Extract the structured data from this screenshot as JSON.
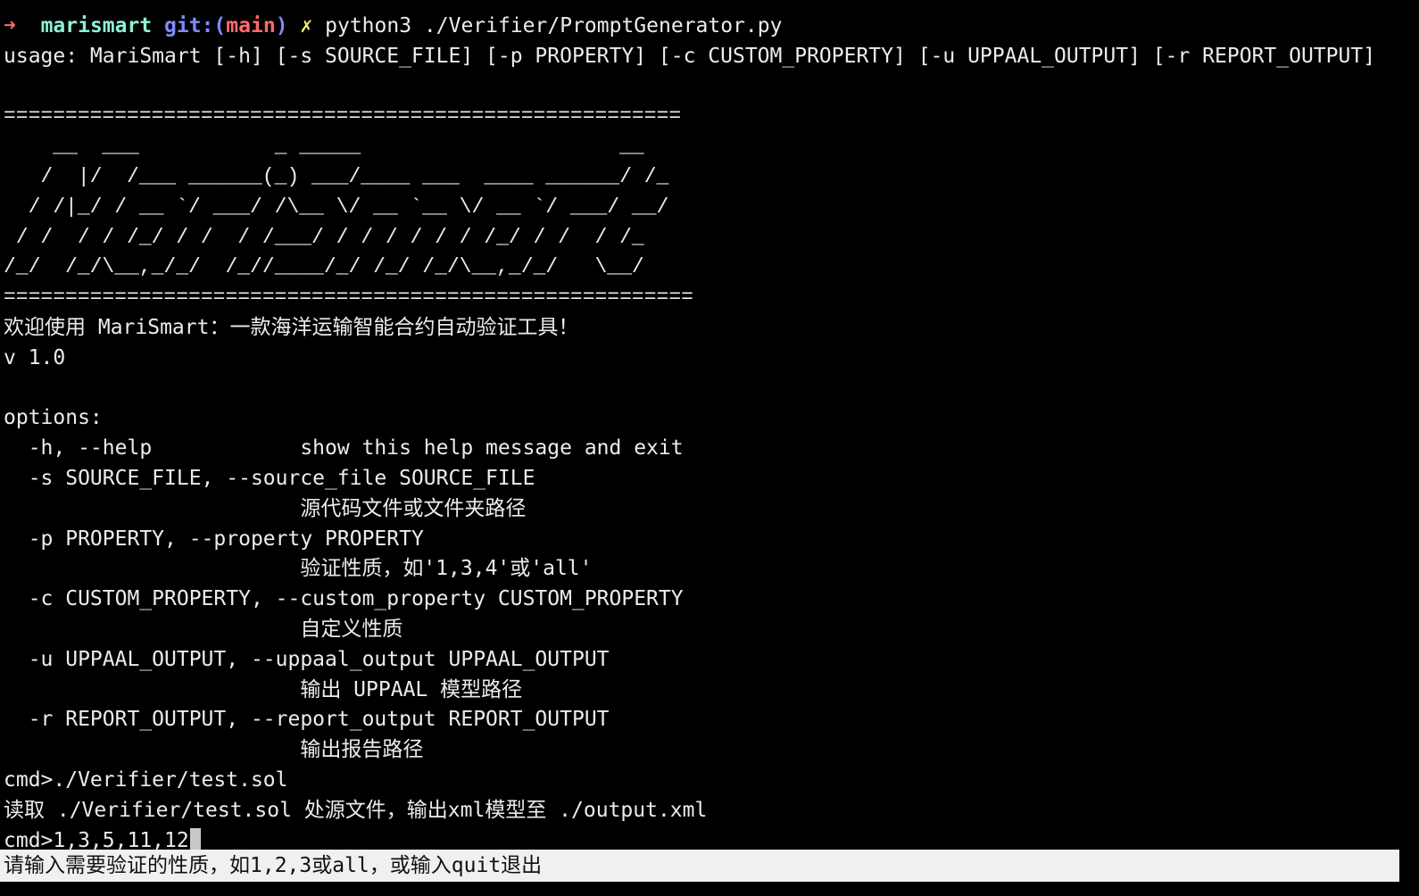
{
  "colors": {
    "background": "#000000",
    "text": "#ececec",
    "prompt_arrow": "#ff6a6a",
    "directory": "#8ff0d6",
    "git_label": "#7f8cff",
    "branch": "#ff6a6a",
    "dirty_marker": "#f3e96b",
    "status_bar_bg": "#f0f0f0",
    "status_bar_text": "#111111"
  },
  "prompt": {
    "arrow": "➜",
    "directory": "marismart",
    "git_label": "git:(",
    "branch": "main",
    "git_close": ")",
    "dirty_marker": "✗",
    "command": "python3 ./Verifier/PromptGenerator.py"
  },
  "usage": "usage: MariSmart [-h] [-s SOURCE_FILE] [-p PROPERTY] [-c CUSTOM_PROPERTY] [-u UPPAAL_OUTPUT] [-r REPORT_OUTPUT]",
  "banner": {
    "rule_top": "=======================================================",
    "art": [
      "    __  ___           _ _____                     __",
      "   /  |/  /___ ______(_) ___/____ ___  ____ ______/ /_",
      "  / /|_/ / __ `/ ___/ /\\__ \\/ __ `__ \\/ __ `/ ___/ __/",
      " / /  / / /_/ / /  / /___/ / / / / / / /_/ / /  / /_",
      "/_/  /_/\\__,_/_/  /_//____/_/ /_/ /_/\\__,_/_/   \\__/"
    ],
    "rule_bottom": "========================================================"
  },
  "welcome": "欢迎使用 MariSmart：一款海洋运输智能合约自动验证工具！",
  "version": "v 1.0",
  "options_header": "options:",
  "options": [
    {
      "flag": "  -h, --help            show this help message and exit"
    },
    {
      "flag": "  -s SOURCE_FILE, --source_file SOURCE_FILE",
      "desc": "                        源代码文件或文件夹路径"
    },
    {
      "flag": "  -p PROPERTY, --property PROPERTY",
      "desc": "                        验证性质，如'1,3,4'或'all'"
    },
    {
      "flag": "  -c CUSTOM_PROPERTY, --custom_property CUSTOM_PROPERTY",
      "desc": "                        自定义性质"
    },
    {
      "flag": "  -u UPPAAL_OUTPUT, --uppaal_output UPPAAL_OUTPUT",
      "desc": "                        输出 UPPAAL 模型路径"
    },
    {
      "flag": "  -r REPORT_OUTPUT, --report_output REPORT_OUTPUT",
      "desc": "                        输出报告路径"
    }
  ],
  "session": {
    "cmd1": "cmd>./Verifier/test.sol",
    "result1": "读取 ./Verifier/test.sol 处源文件，输出xml模型至 ./output.xml",
    "cmd2_prompt": "cmd>",
    "cmd2_input": "1,3,5,11,12"
  },
  "status_bar": "请输入需要验证的性质，如1,2,3或all，或输入quit退出"
}
